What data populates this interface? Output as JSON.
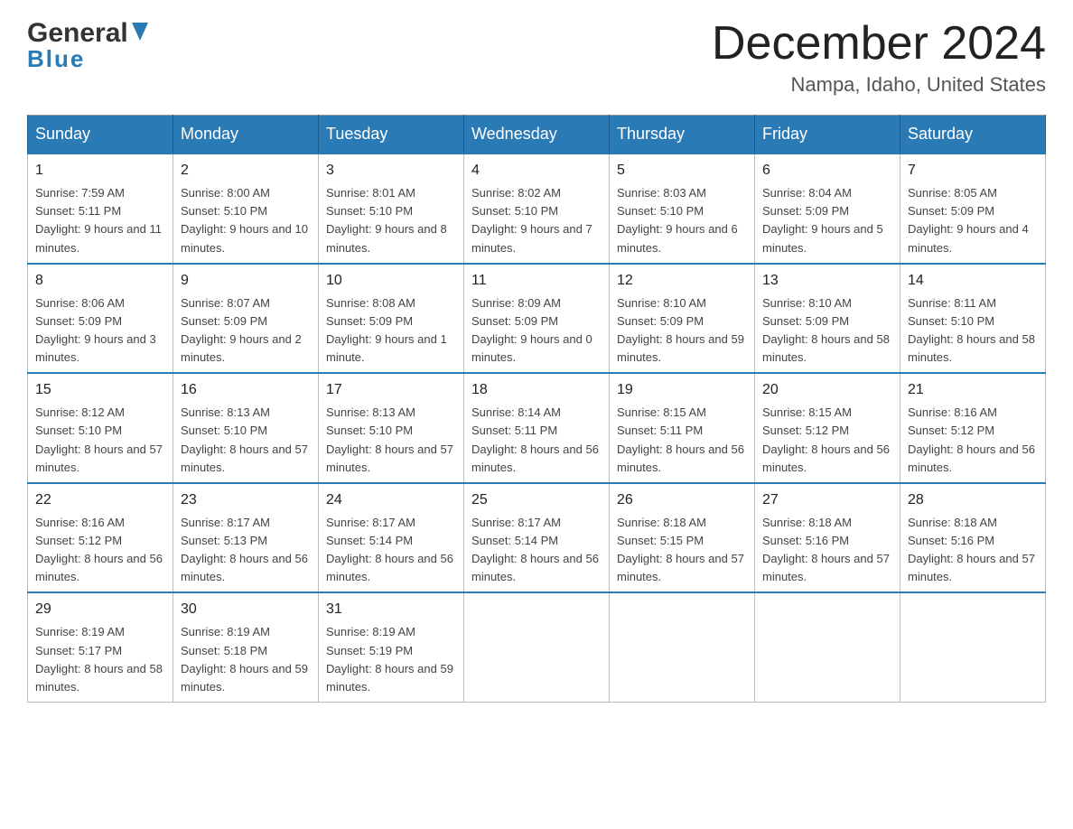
{
  "header": {
    "logo_general": "General",
    "logo_blue": "Blue",
    "title": "December 2024",
    "subtitle": "Nampa, Idaho, United States"
  },
  "days_of_week": [
    "Sunday",
    "Monday",
    "Tuesday",
    "Wednesday",
    "Thursday",
    "Friday",
    "Saturday"
  ],
  "weeks": [
    [
      {
        "day": "1",
        "sunrise": "Sunrise: 7:59 AM",
        "sunset": "Sunset: 5:11 PM",
        "daylight": "Daylight: 9 hours and 11 minutes."
      },
      {
        "day": "2",
        "sunrise": "Sunrise: 8:00 AM",
        "sunset": "Sunset: 5:10 PM",
        "daylight": "Daylight: 9 hours and 10 minutes."
      },
      {
        "day": "3",
        "sunrise": "Sunrise: 8:01 AM",
        "sunset": "Sunset: 5:10 PM",
        "daylight": "Daylight: 9 hours and 8 minutes."
      },
      {
        "day": "4",
        "sunrise": "Sunrise: 8:02 AM",
        "sunset": "Sunset: 5:10 PM",
        "daylight": "Daylight: 9 hours and 7 minutes."
      },
      {
        "day": "5",
        "sunrise": "Sunrise: 8:03 AM",
        "sunset": "Sunset: 5:10 PM",
        "daylight": "Daylight: 9 hours and 6 minutes."
      },
      {
        "day": "6",
        "sunrise": "Sunrise: 8:04 AM",
        "sunset": "Sunset: 5:09 PM",
        "daylight": "Daylight: 9 hours and 5 minutes."
      },
      {
        "day": "7",
        "sunrise": "Sunrise: 8:05 AM",
        "sunset": "Sunset: 5:09 PM",
        "daylight": "Daylight: 9 hours and 4 minutes."
      }
    ],
    [
      {
        "day": "8",
        "sunrise": "Sunrise: 8:06 AM",
        "sunset": "Sunset: 5:09 PM",
        "daylight": "Daylight: 9 hours and 3 minutes."
      },
      {
        "day": "9",
        "sunrise": "Sunrise: 8:07 AM",
        "sunset": "Sunset: 5:09 PM",
        "daylight": "Daylight: 9 hours and 2 minutes."
      },
      {
        "day": "10",
        "sunrise": "Sunrise: 8:08 AM",
        "sunset": "Sunset: 5:09 PM",
        "daylight": "Daylight: 9 hours and 1 minute."
      },
      {
        "day": "11",
        "sunrise": "Sunrise: 8:09 AM",
        "sunset": "Sunset: 5:09 PM",
        "daylight": "Daylight: 9 hours and 0 minutes."
      },
      {
        "day": "12",
        "sunrise": "Sunrise: 8:10 AM",
        "sunset": "Sunset: 5:09 PM",
        "daylight": "Daylight: 8 hours and 59 minutes."
      },
      {
        "day": "13",
        "sunrise": "Sunrise: 8:10 AM",
        "sunset": "Sunset: 5:09 PM",
        "daylight": "Daylight: 8 hours and 58 minutes."
      },
      {
        "day": "14",
        "sunrise": "Sunrise: 8:11 AM",
        "sunset": "Sunset: 5:10 PM",
        "daylight": "Daylight: 8 hours and 58 minutes."
      }
    ],
    [
      {
        "day": "15",
        "sunrise": "Sunrise: 8:12 AM",
        "sunset": "Sunset: 5:10 PM",
        "daylight": "Daylight: 8 hours and 57 minutes."
      },
      {
        "day": "16",
        "sunrise": "Sunrise: 8:13 AM",
        "sunset": "Sunset: 5:10 PM",
        "daylight": "Daylight: 8 hours and 57 minutes."
      },
      {
        "day": "17",
        "sunrise": "Sunrise: 8:13 AM",
        "sunset": "Sunset: 5:10 PM",
        "daylight": "Daylight: 8 hours and 57 minutes."
      },
      {
        "day": "18",
        "sunrise": "Sunrise: 8:14 AM",
        "sunset": "Sunset: 5:11 PM",
        "daylight": "Daylight: 8 hours and 56 minutes."
      },
      {
        "day": "19",
        "sunrise": "Sunrise: 8:15 AM",
        "sunset": "Sunset: 5:11 PM",
        "daylight": "Daylight: 8 hours and 56 minutes."
      },
      {
        "day": "20",
        "sunrise": "Sunrise: 8:15 AM",
        "sunset": "Sunset: 5:12 PM",
        "daylight": "Daylight: 8 hours and 56 minutes."
      },
      {
        "day": "21",
        "sunrise": "Sunrise: 8:16 AM",
        "sunset": "Sunset: 5:12 PM",
        "daylight": "Daylight: 8 hours and 56 minutes."
      }
    ],
    [
      {
        "day": "22",
        "sunrise": "Sunrise: 8:16 AM",
        "sunset": "Sunset: 5:12 PM",
        "daylight": "Daylight: 8 hours and 56 minutes."
      },
      {
        "day": "23",
        "sunrise": "Sunrise: 8:17 AM",
        "sunset": "Sunset: 5:13 PM",
        "daylight": "Daylight: 8 hours and 56 minutes."
      },
      {
        "day": "24",
        "sunrise": "Sunrise: 8:17 AM",
        "sunset": "Sunset: 5:14 PM",
        "daylight": "Daylight: 8 hours and 56 minutes."
      },
      {
        "day": "25",
        "sunrise": "Sunrise: 8:17 AM",
        "sunset": "Sunset: 5:14 PM",
        "daylight": "Daylight: 8 hours and 56 minutes."
      },
      {
        "day": "26",
        "sunrise": "Sunrise: 8:18 AM",
        "sunset": "Sunset: 5:15 PM",
        "daylight": "Daylight: 8 hours and 57 minutes."
      },
      {
        "day": "27",
        "sunrise": "Sunrise: 8:18 AM",
        "sunset": "Sunset: 5:16 PM",
        "daylight": "Daylight: 8 hours and 57 minutes."
      },
      {
        "day": "28",
        "sunrise": "Sunrise: 8:18 AM",
        "sunset": "Sunset: 5:16 PM",
        "daylight": "Daylight: 8 hours and 57 minutes."
      }
    ],
    [
      {
        "day": "29",
        "sunrise": "Sunrise: 8:19 AM",
        "sunset": "Sunset: 5:17 PM",
        "daylight": "Daylight: 8 hours and 58 minutes."
      },
      {
        "day": "30",
        "sunrise": "Sunrise: 8:19 AM",
        "sunset": "Sunset: 5:18 PM",
        "daylight": "Daylight: 8 hours and 59 minutes."
      },
      {
        "day": "31",
        "sunrise": "Sunrise: 8:19 AM",
        "sunset": "Sunset: 5:19 PM",
        "daylight": "Daylight: 8 hours and 59 minutes."
      },
      null,
      null,
      null,
      null
    ]
  ],
  "accent_color": "#2a7ab5"
}
